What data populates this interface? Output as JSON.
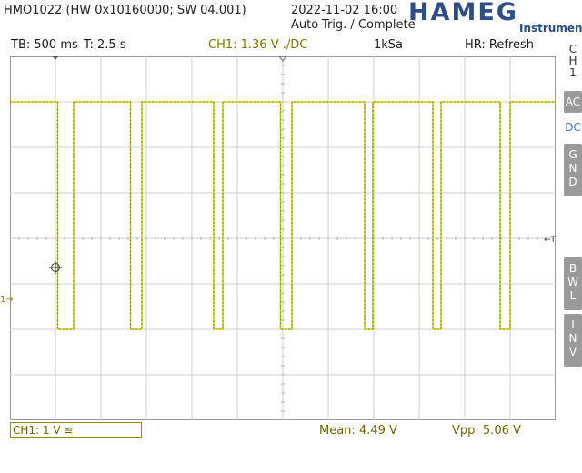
{
  "header": {
    "device": "HMO1022 (HW 0x10160000; SW 04.001)",
    "datetime": "2022-11-02 16:00",
    "trigger_status": "Auto-Trig. / Complete",
    "logo": "HAMEG",
    "logo_sub": "Instruments"
  },
  "info_bar": {
    "timebase": "TB: 500 ms",
    "time": "T: 2.5 s",
    "channel": "CH1: 1.36 V ./DC",
    "sample_rate": "1kSa",
    "mode": "HR: Refresh"
  },
  "side_menu": {
    "channel_label": [
      "C",
      "H",
      "1"
    ],
    "ac": "AC",
    "dc": "DC",
    "gnd": [
      "G",
      "N",
      "D"
    ],
    "bwl": [
      "B",
      "W",
      "L"
    ],
    "inv": [
      "I",
      "N",
      "V"
    ]
  },
  "markers": {
    "channel_marker": "1",
    "trigger_marker": "T"
  },
  "footer": {
    "channel_setting": "CH1: 1 V ≌",
    "mean": "Mean: 4.49 V",
    "vpp": "Vpp: 5.06 V"
  },
  "colors": {
    "trace": "#d4d400",
    "grid": "#cfcfcf",
    "logo": "#2f4e86",
    "accent_text": "#7a7a00"
  },
  "waveform": {
    "high_level_div": 7.0,
    "low_level_div": 2.0,
    "pulses": [
      {
        "start_div": 1.05,
        "end_div": 1.4
      },
      {
        "start_div": 2.65,
        "end_div": 2.9
      },
      {
        "start_div": 4.48,
        "end_div": 4.68
      },
      {
        "start_div": 5.95,
        "end_div": 6.2
      },
      {
        "start_div": 7.8,
        "end_div": 7.98
      },
      {
        "start_div": 9.3,
        "end_div": 9.48
      },
      {
        "start_div": 10.78,
        "end_div": 11.0
      }
    ]
  }
}
